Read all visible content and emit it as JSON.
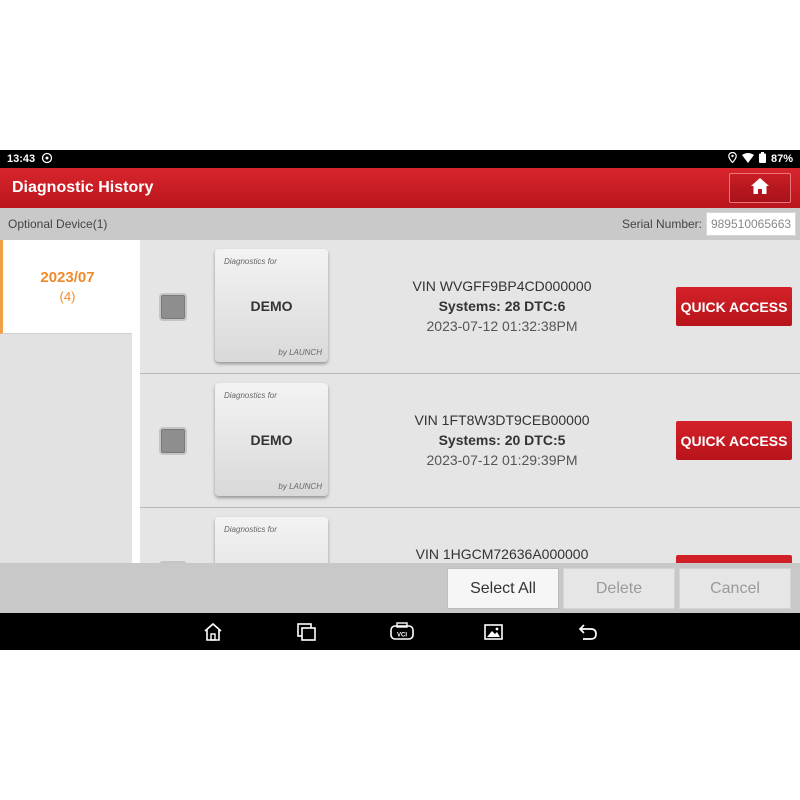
{
  "status_bar": {
    "time": "13:43",
    "battery": "87%"
  },
  "header": {
    "title": "Diagnostic History"
  },
  "subheader": {
    "optional_device": "Optional Device(1)",
    "serial_label": "Serial Number:",
    "serial_value": "989510065663"
  },
  "sidebar": {
    "month": "2023/07",
    "count": "(4)"
  },
  "records": [
    {
      "card_top": "Diagnostics for",
      "card_label": "DEMO",
      "card_bottom": "by LAUNCH",
      "vin": "VIN WVGFF9BP4CD000000",
      "systems": "Systems: 28 DTC:6",
      "datetime": "2023-07-12 01:32:38PM",
      "button": "QUICK ACCESS"
    },
    {
      "card_top": "Diagnostics for",
      "card_label": "DEMO",
      "card_bottom": "by LAUNCH",
      "vin": "VIN 1FT8W3DT9CEB00000",
      "systems": "Systems: 20 DTC:5",
      "datetime": "2023-07-12 01:29:39PM",
      "button": "QUICK ACCESS"
    },
    {
      "card_top": "Diagnostics for",
      "vin": "VIN 1HGCM72636A000000"
    }
  ],
  "actions": {
    "select_all": "Select All",
    "delete": "Delete",
    "cancel": "Cancel"
  },
  "navbar": {
    "icons": [
      "home-icon",
      "recent-apps-icon",
      "vci-icon",
      "gallery-icon",
      "back-icon"
    ],
    "vci_label": "VCI"
  },
  "colors": {
    "brand_red": "#c81e25",
    "accent_orange": "#ef8a2a"
  }
}
